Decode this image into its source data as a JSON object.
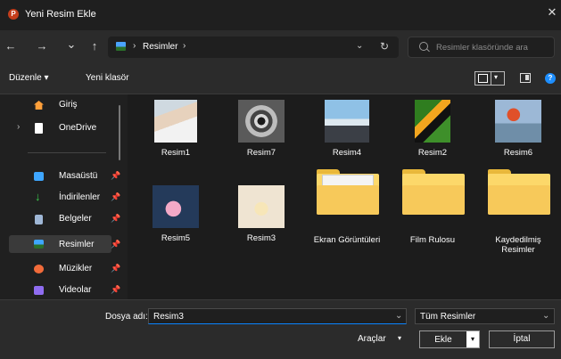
{
  "window": {
    "title": "Yeni Resim Ekle",
    "app_icon_letter": "P",
    "close_glyph": "✕"
  },
  "nav": {
    "back": "←",
    "forward": "→",
    "recent": "⌄",
    "up": "↑"
  },
  "address": {
    "chevron": "›",
    "location": "Resimler",
    "dropdown": "⌄",
    "refresh": "↻"
  },
  "search": {
    "placeholder": "Resimler klasöründe ara"
  },
  "toolbar": {
    "organize": "Düzenle ▾",
    "new_folder": "Yeni klasör",
    "view_caret": "▾",
    "help": "?"
  },
  "sidebar": {
    "expander": "›",
    "pin_glyph": "📌",
    "items": [
      {
        "label": "Giriş",
        "icon": "home-icon",
        "color": "#ff9f3a"
      },
      {
        "label": "OneDrive",
        "icon": "document-icon",
        "color": "#ffffff"
      },
      {
        "label": "Masaüstü",
        "icon": "desktop-icon",
        "color": "#3ea6ff"
      },
      {
        "label": "İndirilenler",
        "icon": "download-icon",
        "color": "#3ccf4e"
      },
      {
        "label": "Belgeler",
        "icon": "documents-icon",
        "color": "#9fb7d6"
      },
      {
        "label": "Resimler",
        "icon": "pictures-icon",
        "color": "#3ea6ff"
      },
      {
        "label": "Müzikler",
        "icon": "music-icon",
        "color": "#f26b3a"
      },
      {
        "label": "Videolar",
        "icon": "video-icon",
        "color": "#8f6cf0"
      }
    ]
  },
  "files": [
    {
      "name": "Resim1",
      "kind": "image"
    },
    {
      "name": "Resim7",
      "kind": "image"
    },
    {
      "name": "Resim4",
      "kind": "image"
    },
    {
      "name": "Resim2",
      "kind": "image"
    },
    {
      "name": "Resim6",
      "kind": "image"
    },
    {
      "name": "Resim5",
      "kind": "image"
    },
    {
      "name": "Resim3",
      "kind": "image"
    },
    {
      "name": "Ekran Görüntüleri",
      "kind": "folder"
    },
    {
      "name": "Film Rulosu",
      "kind": "folder"
    },
    {
      "name": "Kaydedilmiş Resimler",
      "kind": "folder"
    }
  ],
  "footer": {
    "filename_label": "Dosya adı:",
    "filename_value": "Resim3",
    "filetype_value": "Tüm Resimler",
    "tools_label": "Araçlar",
    "tools_caret": "▾",
    "insert_label": "Ekle",
    "insert_caret": "▾",
    "cancel_label": "İptal",
    "dropdown_caret": "⌄"
  },
  "colors": {
    "accent": "#0a84ff",
    "folder": "#fcd86a",
    "background": "#202020"
  }
}
